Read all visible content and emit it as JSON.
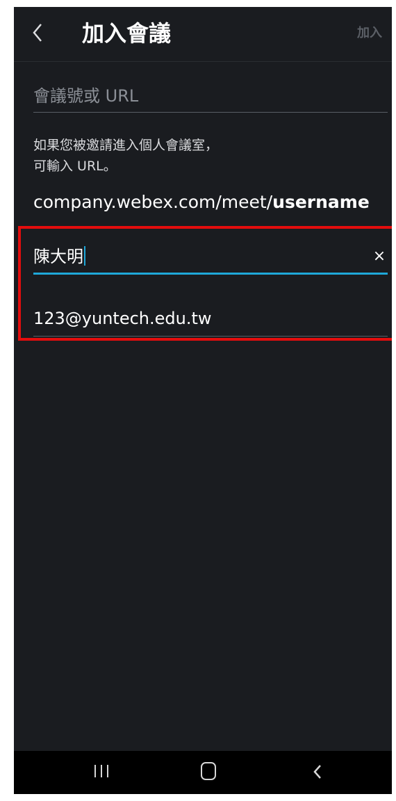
{
  "header": {
    "title": "加入會議",
    "join_label": "加入"
  },
  "meeting_input": {
    "placeholder": "會議號或 URL"
  },
  "hint": {
    "line1": "如果您被邀請進入個人會議室，",
    "line2": "可輸入 URL。"
  },
  "example_url": {
    "prefix": "company.webex.com/meet/",
    "suffix": "username"
  },
  "name_input": {
    "value": "陳大明",
    "clear_label": "×"
  },
  "email_input": {
    "value": "123@yuntech.edu.tw"
  },
  "colors": {
    "background": "#1a1c20",
    "accent": "#1fa8d9",
    "highlight": "#e30d0d",
    "disabled_text": "#5b5f66"
  },
  "icons": [
    "back-arrow-icon",
    "clear-icon",
    "recent-apps-icon",
    "home-icon",
    "nav-back-icon"
  ]
}
